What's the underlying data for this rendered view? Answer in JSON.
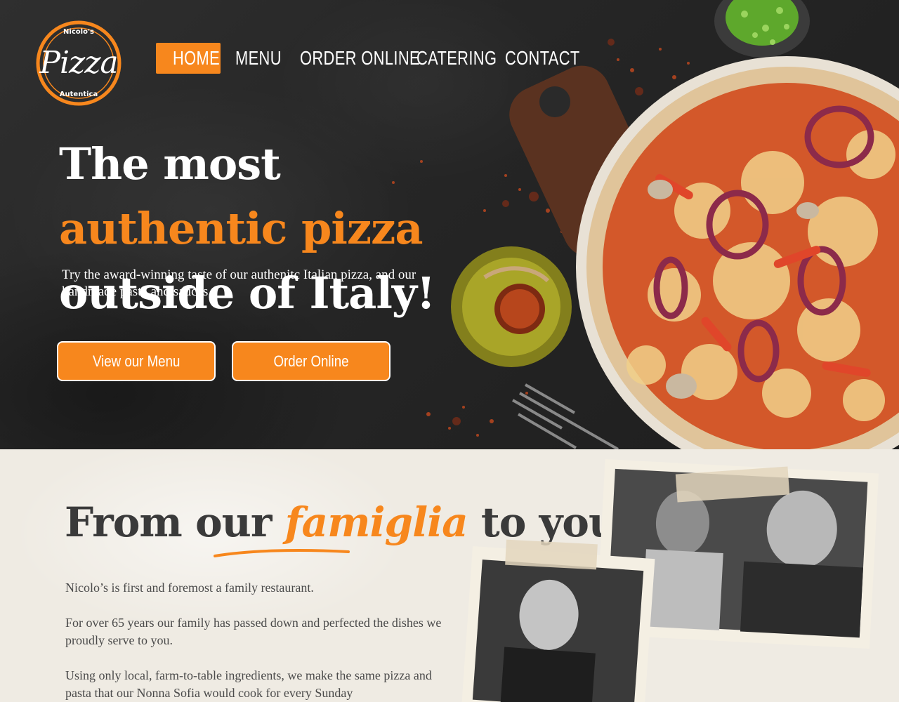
{
  "brand": {
    "logo_top": "Nicolo's",
    "logo_word": "Pizza",
    "logo_bottom": "Autentica"
  },
  "nav": {
    "items": [
      {
        "label": "HOME",
        "active": true
      },
      {
        "label": "MENU",
        "active": false
      },
      {
        "label": "ORDER ONLINE",
        "active": false
      },
      {
        "label": "CATERING",
        "active": false
      },
      {
        "label": "CONTACT",
        "active": false
      }
    ]
  },
  "hero": {
    "headline_part1": "The most ",
    "headline_accent": "authentic pizza",
    "headline_part2": "outside of Italy!",
    "subtext": "Try the award-winning taste of our authenitc Italian pizza, and our handmade pasta and sauces.",
    "button_menu": "View our Menu",
    "button_order": "Order Online"
  },
  "story": {
    "title_part1": "From our ",
    "title_accent": "famiglia",
    "title_part2": " to yours.",
    "paragraphs": [
      "Nicolo’s is first and foremost a family restaurant.",
      "For over 65 years our family has passed down and perfected the dishes we proudly serve to you.",
      "Using only local, farm-to-table ingredients, we make the same pizza and pasta that our Nonna Sofia would cook for every Sunday"
    ]
  },
  "colors": {
    "accent": "#f7871d",
    "hero_bg": "#262626",
    "paper_bg": "#efebe3",
    "text_dark": "#3a3a3a"
  },
  "icons": {
    "logo": "pizza-logo-badge",
    "underline": "brush-underline"
  }
}
